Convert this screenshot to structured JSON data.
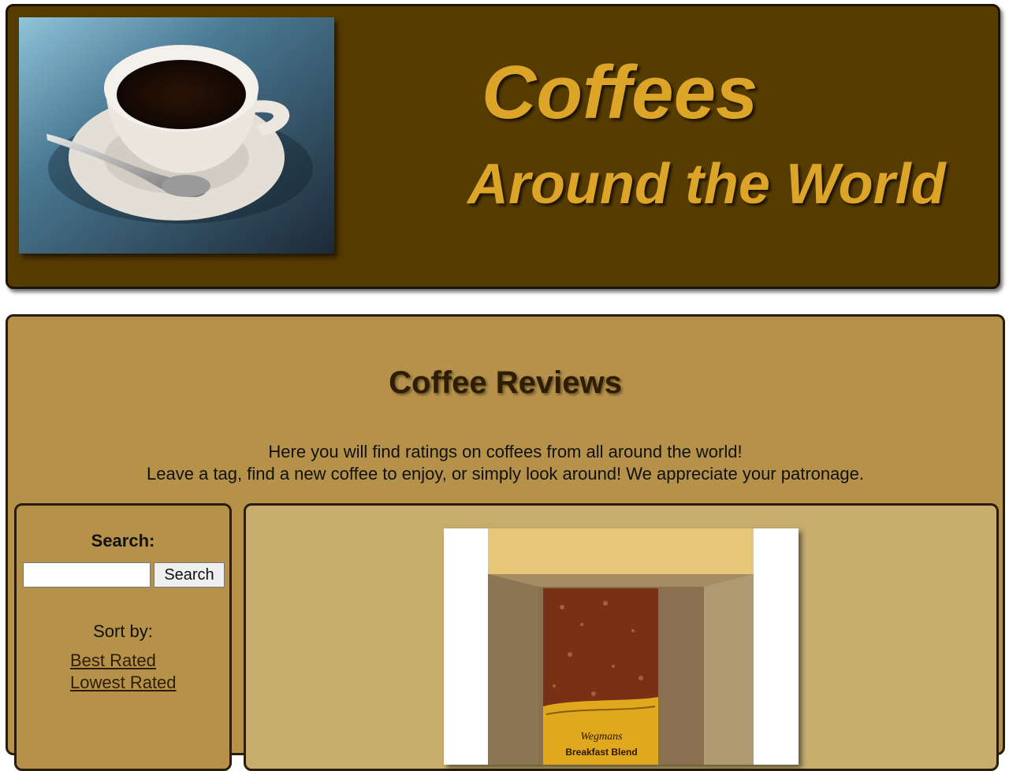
{
  "header": {
    "photo_icon": "coffee-cup-photo",
    "title_line1": "Coffees",
    "title_line2": "Around the World"
  },
  "main": {
    "heading": "Coffee Reviews",
    "intro_line1": "Here you will find ratings on coffees from all around the world!",
    "intro_line2": "Leave a tag, find a new coffee to enjoy, or simply look around! We appreciate your patronage."
  },
  "sidebar": {
    "search_label": "Search:",
    "search_value": "",
    "search_button": "Search",
    "sort_label": "Sort by:",
    "sort_options": [
      "Best Rated",
      "Lowest Rated"
    ]
  },
  "review": {
    "product_photo_icon": "coffee-bag-in-box-photo",
    "bag_brand": "Wegmans",
    "bag_label": "Breakfast Blend"
  },
  "colors": {
    "header_bg": "#573c00",
    "title_gold": "#dca527",
    "main_bg": "#b5914a",
    "panel_bg": "#c6ad6e",
    "border": "#2a1d08"
  }
}
